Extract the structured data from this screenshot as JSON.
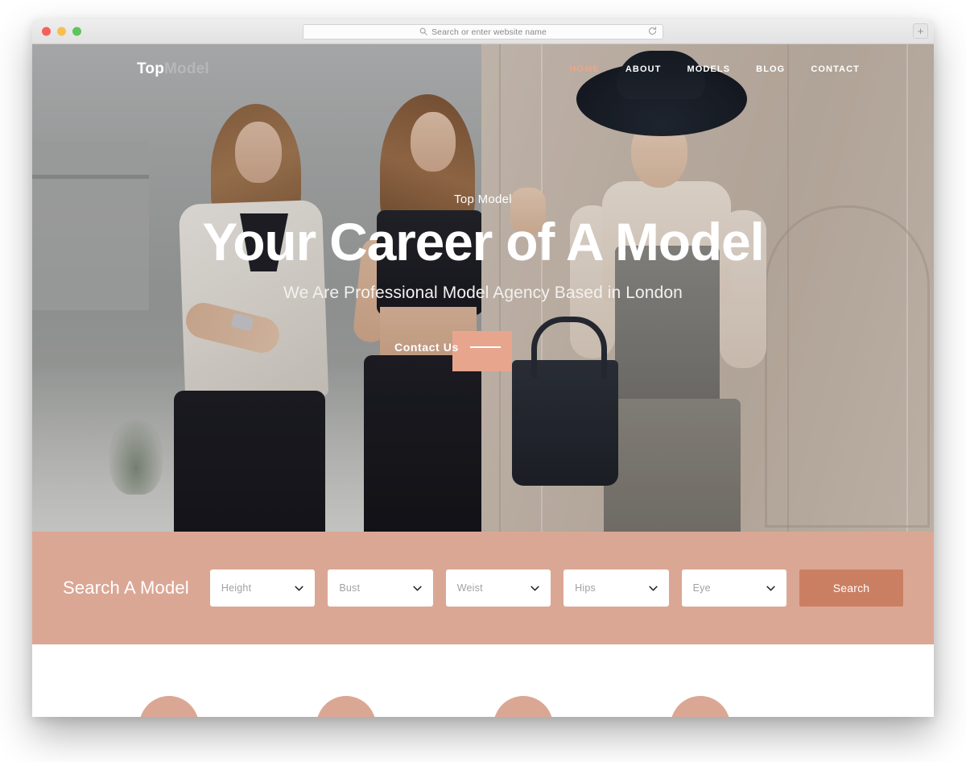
{
  "browser": {
    "traffic_lights": [
      "close",
      "minimize",
      "zoom"
    ],
    "address_placeholder": "Search or enter website name",
    "search_icon": "search-icon",
    "reload_icon": "reload-icon",
    "new_tab_label": "+"
  },
  "site": {
    "logo": {
      "bold": "Top",
      "light": "Model"
    },
    "nav": [
      {
        "label": "HOME",
        "active": true
      },
      {
        "label": "ABOUT",
        "active": false
      },
      {
        "label": "MODELS",
        "active": false
      },
      {
        "label": "BLOG",
        "active": false
      },
      {
        "label": "CONTACT",
        "active": false
      }
    ],
    "hero": {
      "eyebrow": "Top Model",
      "title": "Your Career of A Model",
      "subtitle": "We Are Professional Model Agency Based in London",
      "cta_label": "Contact Us"
    },
    "search": {
      "title": "Search A Model",
      "fields": [
        {
          "name": "height",
          "value": "Height"
        },
        {
          "name": "bust",
          "value": "Bust"
        },
        {
          "name": "weist",
          "value": "Weist"
        },
        {
          "name": "hips",
          "value": "Hips"
        },
        {
          "name": "eye",
          "value": "Eye"
        }
      ],
      "submit_label": "Search"
    },
    "features": {
      "count": 4
    }
  },
  "colors": {
    "accent": "#dba795",
    "accent_dark": "#cb7f62",
    "nav_active": "#e8a58d",
    "cta_block": "#e8a58d",
    "text_white": "#ffffff",
    "logo_light": "#b7b7b7"
  }
}
